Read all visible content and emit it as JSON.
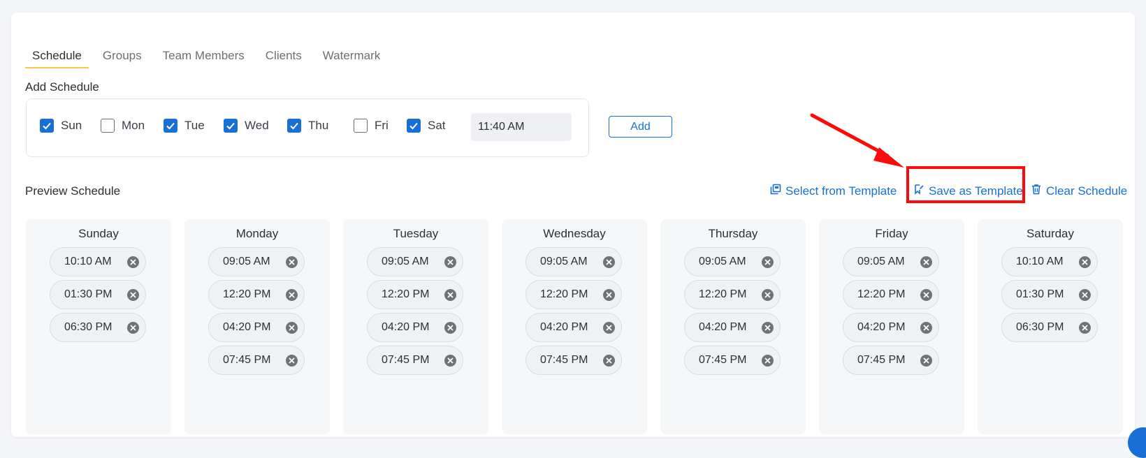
{
  "tabs": [
    "Schedule",
    "Groups",
    "Team Members",
    "Clients",
    "Watermark"
  ],
  "add_schedule": {
    "title": "Add Schedule",
    "days": [
      {
        "label": "Sun",
        "checked": true
      },
      {
        "label": "Mon",
        "checked": false
      },
      {
        "label": "Tue",
        "checked": true
      },
      {
        "label": "Wed",
        "checked": true
      },
      {
        "label": "Thu",
        "checked": true
      },
      {
        "label": "Fri",
        "checked": false
      },
      {
        "label": "Sat",
        "checked": true
      }
    ],
    "time_value": "11:40 AM",
    "add_label": "Add"
  },
  "preview": {
    "title": "Preview Schedule",
    "select_template_label": "Select from Template",
    "save_template_label": "Save as Template",
    "clear_label": "Clear Schedule"
  },
  "week": [
    {
      "day": "Sunday",
      "times": [
        "10:10 AM",
        "01:30 PM",
        "06:30 PM"
      ]
    },
    {
      "day": "Monday",
      "times": [
        "09:05 AM",
        "12:20 PM",
        "04:20 PM",
        "07:45 PM"
      ]
    },
    {
      "day": "Tuesday",
      "times": [
        "09:05 AM",
        "12:20 PM",
        "04:20 PM",
        "07:45 PM"
      ]
    },
    {
      "day": "Wednesday",
      "times": [
        "09:05 AM",
        "12:20 PM",
        "04:20 PM",
        "07:45 PM"
      ]
    },
    {
      "day": "Thursday",
      "times": [
        "09:05 AM",
        "12:20 PM",
        "04:20 PM",
        "07:45 PM"
      ]
    },
    {
      "day": "Friday",
      "times": [
        "09:05 AM",
        "12:20 PM",
        "04:20 PM",
        "07:45 PM"
      ]
    },
    {
      "day": "Saturday",
      "times": [
        "10:10 AM",
        "01:30 PM",
        "06:30 PM"
      ]
    }
  ],
  "colors": {
    "accent": "#1a6fd6",
    "annotation": "#ff0a0a",
    "tab_underline": "#f2c94c"
  }
}
